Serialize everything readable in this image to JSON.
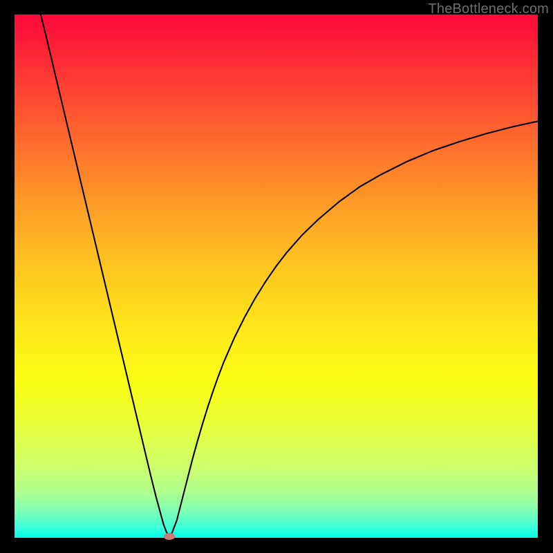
{
  "attribution": "TheBottleneck.com",
  "colors": {
    "frame": "#000000",
    "curve": "#000000",
    "marker": "#cb7c7b",
    "attribution_text": "#6e6e6e"
  },
  "chart_data": {
    "type": "line",
    "title": "",
    "xlabel": "",
    "ylabel": "",
    "xlim": [
      0,
      100
    ],
    "ylim": [
      0,
      100
    ],
    "grid": false,
    "legend": false,
    "series": [
      {
        "name": "bottleneck-curve",
        "x": [
          5,
          6,
          7,
          8,
          9,
          10,
          11,
          12,
          13,
          14,
          15,
          16,
          17,
          18,
          19,
          20,
          21,
          22,
          23,
          24,
          25,
          26,
          27,
          28,
          28.5,
          29,
          29.3,
          29.6,
          30,
          31,
          32,
          33,
          34,
          35,
          36,
          37,
          38,
          39,
          40,
          42,
          44,
          46,
          48,
          50,
          52,
          55,
          58,
          62,
          66,
          70,
          75,
          80,
          85,
          90,
          95,
          100
        ],
        "y": [
          100,
          96,
          91.8,
          87.6,
          83.4,
          79.2,
          75,
          70.8,
          66.6,
          62.4,
          58.2,
          54,
          49.8,
          45.6,
          41.4,
          37.2,
          33,
          28.8,
          24.6,
          20.4,
          16.2,
          12,
          8,
          4.3,
          2.5,
          1.2,
          0.6,
          0.3,
          0.7,
          3.3,
          7.2,
          11.1,
          15,
          18.6,
          22,
          25.2,
          28.2,
          31,
          33.6,
          38.2,
          42.2,
          45.8,
          49,
          51.9,
          54.5,
          57.9,
          60.8,
          64.2,
          67.1,
          69.4,
          71.9,
          74,
          75.7,
          77.2,
          78.5,
          79.6
        ]
      }
    ],
    "minimum_point": {
      "x": 29.6,
      "y": 0.3
    }
  }
}
